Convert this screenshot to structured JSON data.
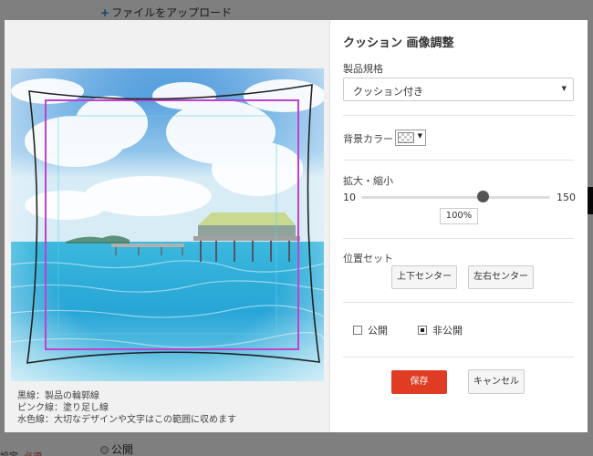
{
  "background": {
    "upload_link": "ファイルをアップロード",
    "bottom_radio_label": "公開",
    "bottom_left_label": "設定",
    "bottom_left_required": "必須"
  },
  "modal": {
    "title": "クッション 画像調整",
    "product_spec": {
      "label": "製品規格",
      "selected": "クッション付き"
    },
    "background_color": {
      "label": "背景カラー"
    },
    "zoom": {
      "label": "拡大・縮小",
      "min": 10,
      "max": 150,
      "value": 100,
      "display": "100%"
    },
    "position": {
      "label": "位置セット",
      "vertical_center": "上下センター",
      "horizontal_center": "左右センター"
    },
    "visibility": {
      "public_label": "公開",
      "private_label": "非公開",
      "selected": "private"
    },
    "actions": {
      "save": "保存",
      "cancel": "キャンセル"
    },
    "legend": {
      "black_line": "黒線：製品の輪郭線",
      "pink_line": "ピンク線：塗り足し線",
      "blue_line": "水色線：大切なデザインや文字はこの範囲に収めます"
    }
  },
  "colors": {
    "accent_save": "#e03c23",
    "bleed_line": "#c040d0",
    "outline": "#222222",
    "safe_line": "#66ccee"
  }
}
